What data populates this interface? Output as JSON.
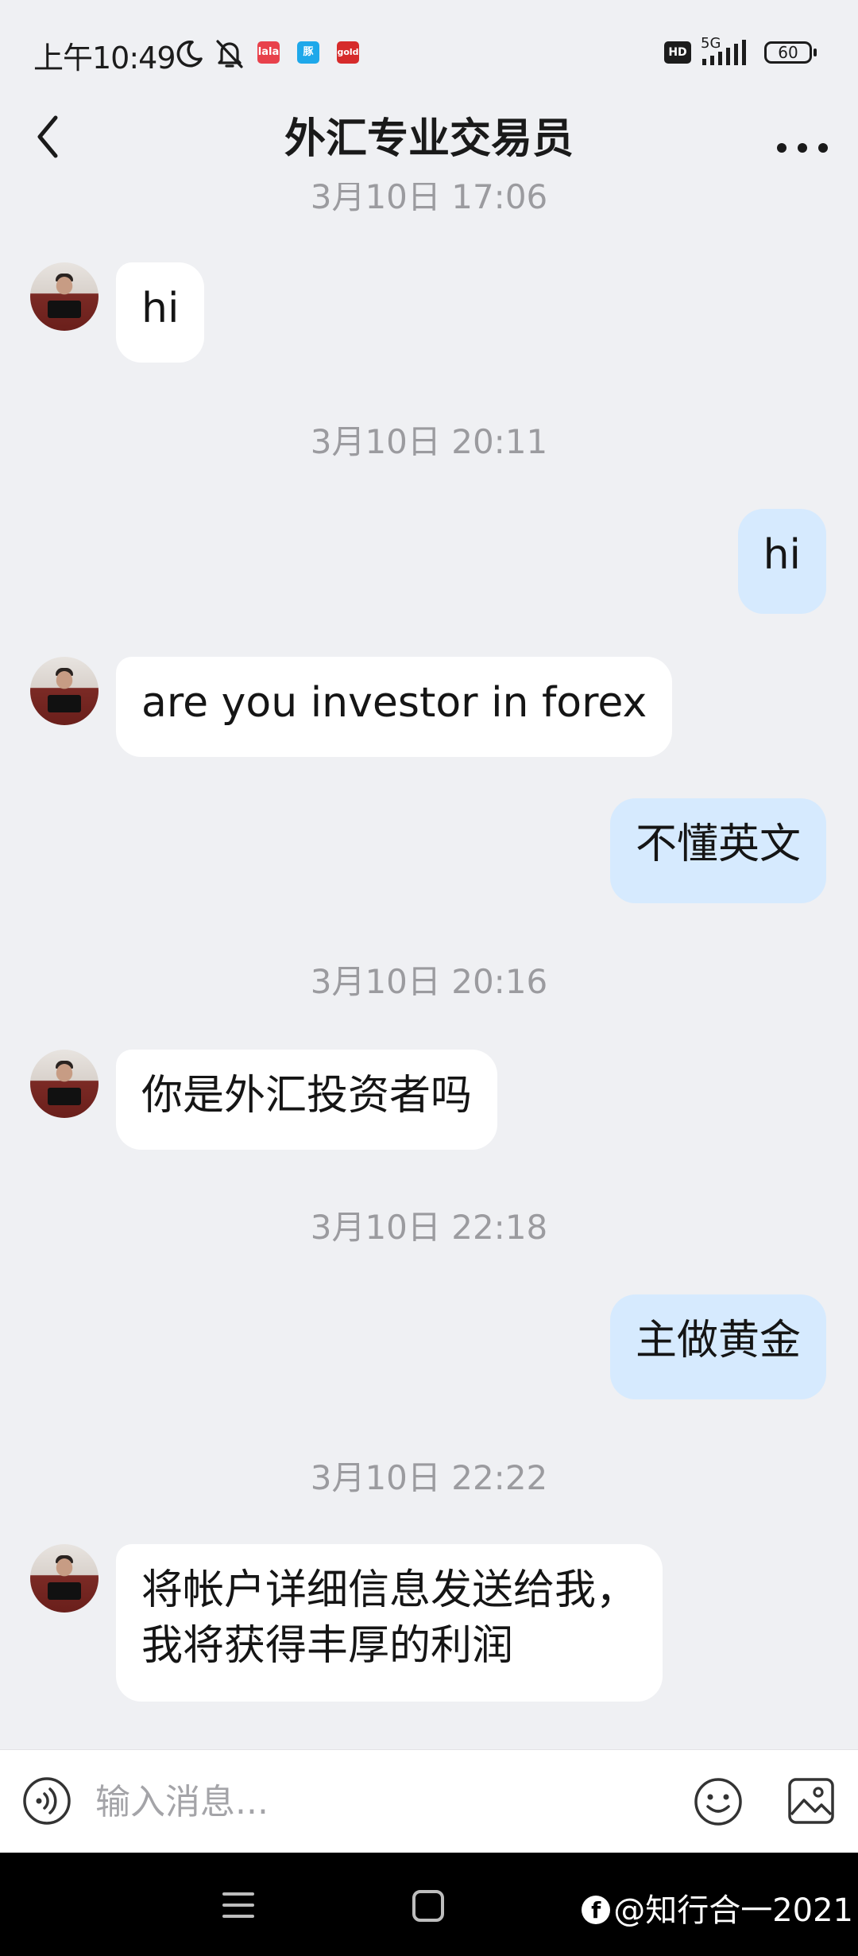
{
  "status_bar": {
    "time": "上午10:49",
    "app_badges": [
      "lala",
      "豚",
      "gold"
    ],
    "hd": "HD",
    "network": "5G",
    "battery": "60"
  },
  "header": {
    "title": "外汇专业交易员"
  },
  "messages": [
    {
      "type": "timestamp",
      "text": "3月10日 17:06"
    },
    {
      "type": "incoming",
      "text": "hi"
    },
    {
      "type": "timestamp",
      "text": "3月10日 20:11"
    },
    {
      "type": "outgoing",
      "text": "hi"
    },
    {
      "type": "incoming",
      "text": "are you investor in forex"
    },
    {
      "type": "outgoing",
      "text": "不懂英文"
    },
    {
      "type": "timestamp",
      "text": "3月10日 20:16"
    },
    {
      "type": "incoming",
      "text": "你是外汇投资者吗"
    },
    {
      "type": "timestamp",
      "text": "3月10日 22:18"
    },
    {
      "type": "outgoing",
      "text": "主做黄金"
    },
    {
      "type": "timestamp",
      "text": "3月10日 22:22"
    },
    {
      "type": "incoming",
      "text": "将帐户详细信息发送给我，\n我将获得丰厚的利润"
    }
  ],
  "composer": {
    "placeholder": "输入消息..."
  },
  "watermark": "@知行合一2021",
  "colors": {
    "background": "#eff0f3",
    "incoming_bubble": "#ffffff",
    "outgoing_bubble": "#d6eafe"
  }
}
